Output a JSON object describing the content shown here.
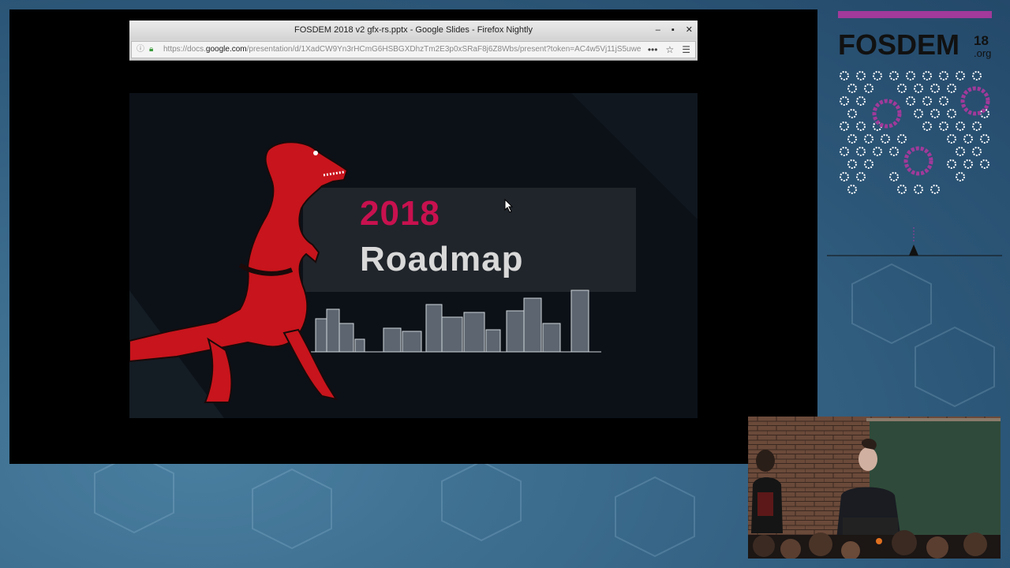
{
  "window": {
    "title": "FOSDEM 2018 v2 gfx-rs.pptx - Google Slides - Firefox Nightly",
    "buttons": {
      "minimize": "–",
      "maximize": "▪",
      "close": "✕"
    }
  },
  "urlbar": {
    "url_prefix": "https://docs.",
    "url_domain": "google.com",
    "url_suffix": "/presentation/d/1XadCW9Yn3rHCmG6HSBGXDhzTm2E3p0xSRaF8j6Z8Wbs/present?token=AC4w5Vj11jS5uwe",
    "tools": [
      "•••",
      "☆",
      "☰"
    ]
  },
  "slide": {
    "year": "2018",
    "title": "Roadmap"
  },
  "branding": {
    "name": "FOSDEM",
    "year_suffix": "18",
    "domain_suffix": ".org"
  },
  "colors": {
    "accent_magenta": "#c8114f",
    "trex_red": "#c8141c",
    "fosdem_purple": "#a13a9a"
  }
}
